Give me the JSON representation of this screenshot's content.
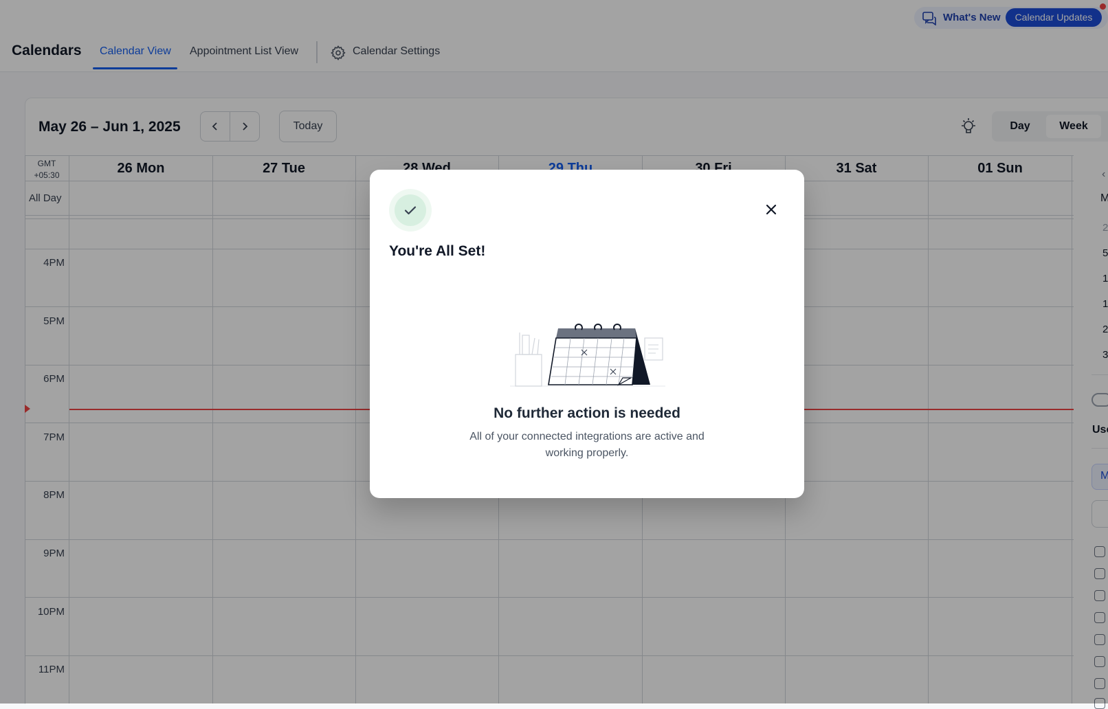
{
  "header": {
    "title": "Calendars",
    "tabs": [
      {
        "label": "Calendar View",
        "active": true
      },
      {
        "label": "Appointment List View",
        "active": false
      }
    ],
    "settings_label": "Calendar Settings",
    "whats_new_label": "What's New",
    "updates_label": "Calendar Updates"
  },
  "toolbar": {
    "date_range": "May 26 – Jun 1, 2025",
    "today_label": "Today",
    "view_options": [
      "Day",
      "Week"
    ],
    "active_view": "Week"
  },
  "grid": {
    "timezone_line1": "GMT",
    "timezone_line2": "+05:30",
    "all_day_label": "All Day",
    "days": [
      {
        "label": "26 Mon"
      },
      {
        "label": "27 Tue"
      },
      {
        "label": "28 Wed"
      },
      {
        "label": "29 Thu",
        "today": true
      },
      {
        "label": "30 Fri"
      },
      {
        "label": "31 Sat"
      },
      {
        "label": "01 Sun"
      }
    ],
    "hours": [
      "4PM",
      "5PM",
      "6PM",
      "7PM",
      "8PM",
      "9PM",
      "10PM",
      "11PM"
    ]
  },
  "sidebar": {
    "weekday_initial": "M",
    "date_digits": [
      "2",
      "5",
      "1",
      "1",
      "2",
      "3"
    ],
    "section_label": "Use",
    "pill_initial": "M"
  },
  "modal": {
    "title": "You're All Set!",
    "heading": "No further action is needed",
    "body": "All of your connected integrations are active and working properly."
  },
  "colors": {
    "accent": "#155eef",
    "now_line": "#ef4444",
    "success_bg": "#eef8f1"
  },
  "icons": [
    "settings-gear-icon",
    "whats-new-icon",
    "chevron-left-icon",
    "chevron-right-icon",
    "lightbulb-icon",
    "check-icon",
    "close-icon",
    "calendar-illustration"
  ]
}
